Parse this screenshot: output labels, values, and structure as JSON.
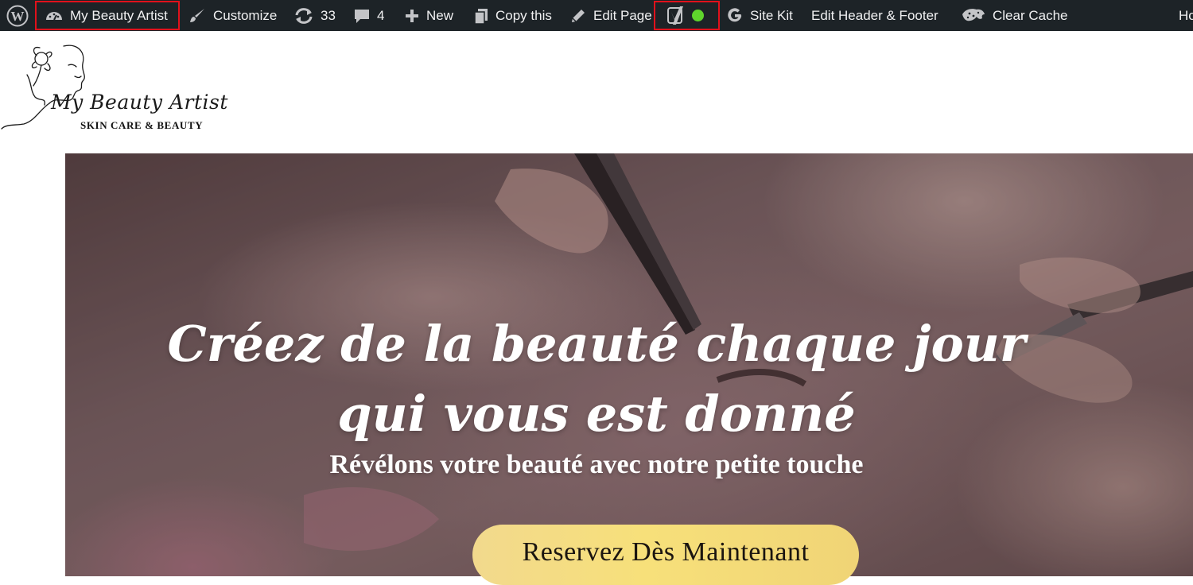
{
  "admin_bar": {
    "site_name": "My Beauty Artist",
    "customize": "Customize",
    "updates_count": "33",
    "comments_count": "4",
    "new": "New",
    "copy_this": "Copy this",
    "edit_page": "Edit Page",
    "site_kit": "Site Kit",
    "edit_header_footer": "Edit Header & Footer",
    "clear_cache": "Clear Cache",
    "howdy_truncated": "Ho",
    "seo_status_color": "#5fd42c",
    "highlight_color": "#e1111b",
    "bar_color": "#1d2327"
  },
  "logo": {
    "script_name": "My Beauty Artist",
    "tagline": "SKIN CARE & BEAUTY"
  },
  "hero": {
    "title_line1": "Créez de la beauté chaque jour",
    "title_line2": "qui vous est donné",
    "subtitle": "Révélons votre beauté avec notre petite touche",
    "cta_label": "Reservez Dès Maintenant",
    "cta_color": "#f5dc80"
  }
}
